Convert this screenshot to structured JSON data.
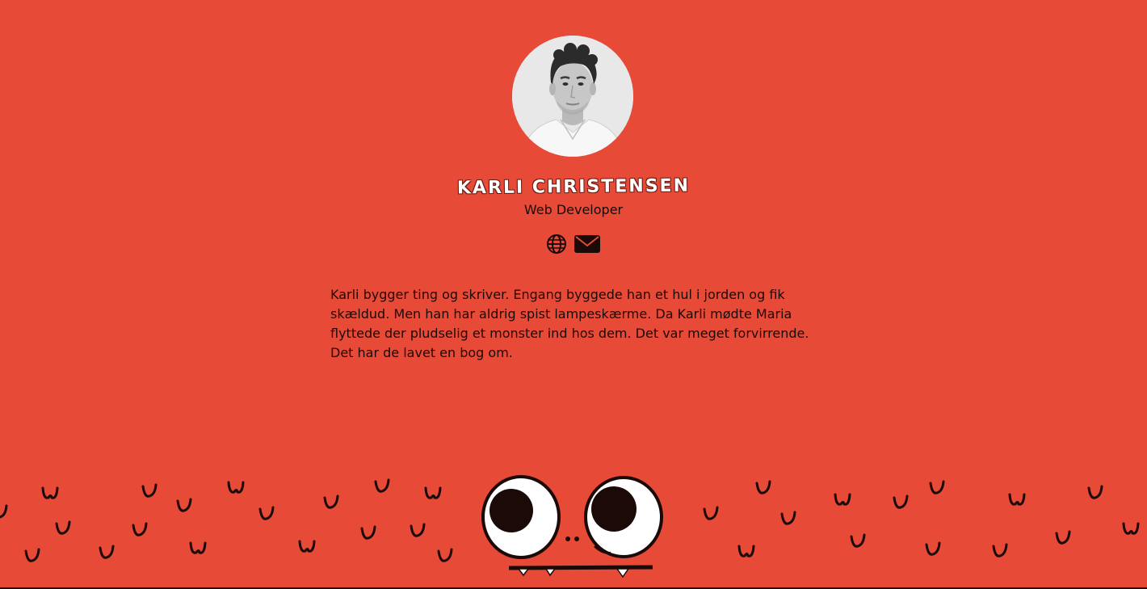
{
  "profile": {
    "name": "Karli Christensen",
    "role": "Web Developer",
    "bio": "Karli bygger ting og skriver. Engang byggede han et hul i jorden og fik skældud. Men han har aldrig spist lampeskærme. Da Karli mødte Maria flyttede der pludselig et monster ind hos dem. Det var meget forvirrende. Det har de lavet en bog om."
  },
  "links": [
    {
      "icon": "globe-icon"
    },
    {
      "icon": "envelope-icon"
    }
  ],
  "colors": {
    "background": "#e74a37",
    "text": "#1b0a08",
    "name": "#ffffff"
  }
}
